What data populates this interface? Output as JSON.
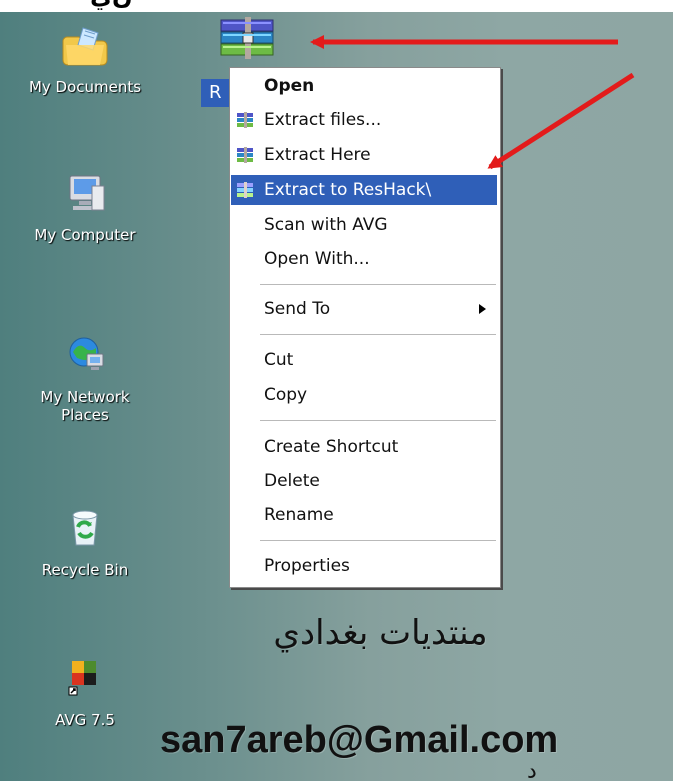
{
  "desktop": {
    "top_fragment": "ن‌ي ᓪ",
    "icons": [
      {
        "name": "my-documents",
        "label": "My Documents",
        "icon": "folder-documents-icon"
      },
      {
        "name": "my-computer",
        "label": "My Computer",
        "icon": "computer-icon"
      },
      {
        "name": "my-network-places",
        "label": "My Network\nPlaces",
        "icon": "network-icon"
      },
      {
        "name": "recycle-bin",
        "label": "Recycle Bin",
        "icon": "recycle-bin-icon"
      },
      {
        "name": "avg-7-5",
        "label": "AVG 7.5",
        "icon": "avg-icon"
      }
    ],
    "selected_file_label": "R"
  },
  "context_menu": {
    "items": [
      {
        "label": "Open",
        "bold": true,
        "icon": ""
      },
      {
        "label": "Extract files...",
        "icon": "winrar-icon"
      },
      {
        "label": "Extract Here",
        "icon": "winrar-icon"
      },
      {
        "label": "Extract to ResHack\\",
        "icon": "winrar-icon",
        "highlighted": true
      },
      {
        "label": "Scan with AVG",
        "icon": ""
      },
      {
        "label": "Open With...",
        "icon": ""
      },
      {
        "label": "Send To",
        "icon": "",
        "submenu": true
      },
      {
        "label": "Cut",
        "icon": ""
      },
      {
        "label": "Copy",
        "icon": ""
      },
      {
        "label": "Create Shortcut",
        "icon": ""
      },
      {
        "label": "Delete",
        "icon": ""
      },
      {
        "label": "Rename",
        "icon": ""
      },
      {
        "label": "Properties",
        "icon": ""
      }
    ]
  },
  "captions": {
    "arabic": "منتديات بغدادي",
    "email": "san7areb@Gmail.com",
    "bottom_fragment": "د"
  },
  "colors": {
    "desktop": "#6f9290",
    "highlight": "#2f5fb8",
    "arrow": "#e31b1b"
  }
}
